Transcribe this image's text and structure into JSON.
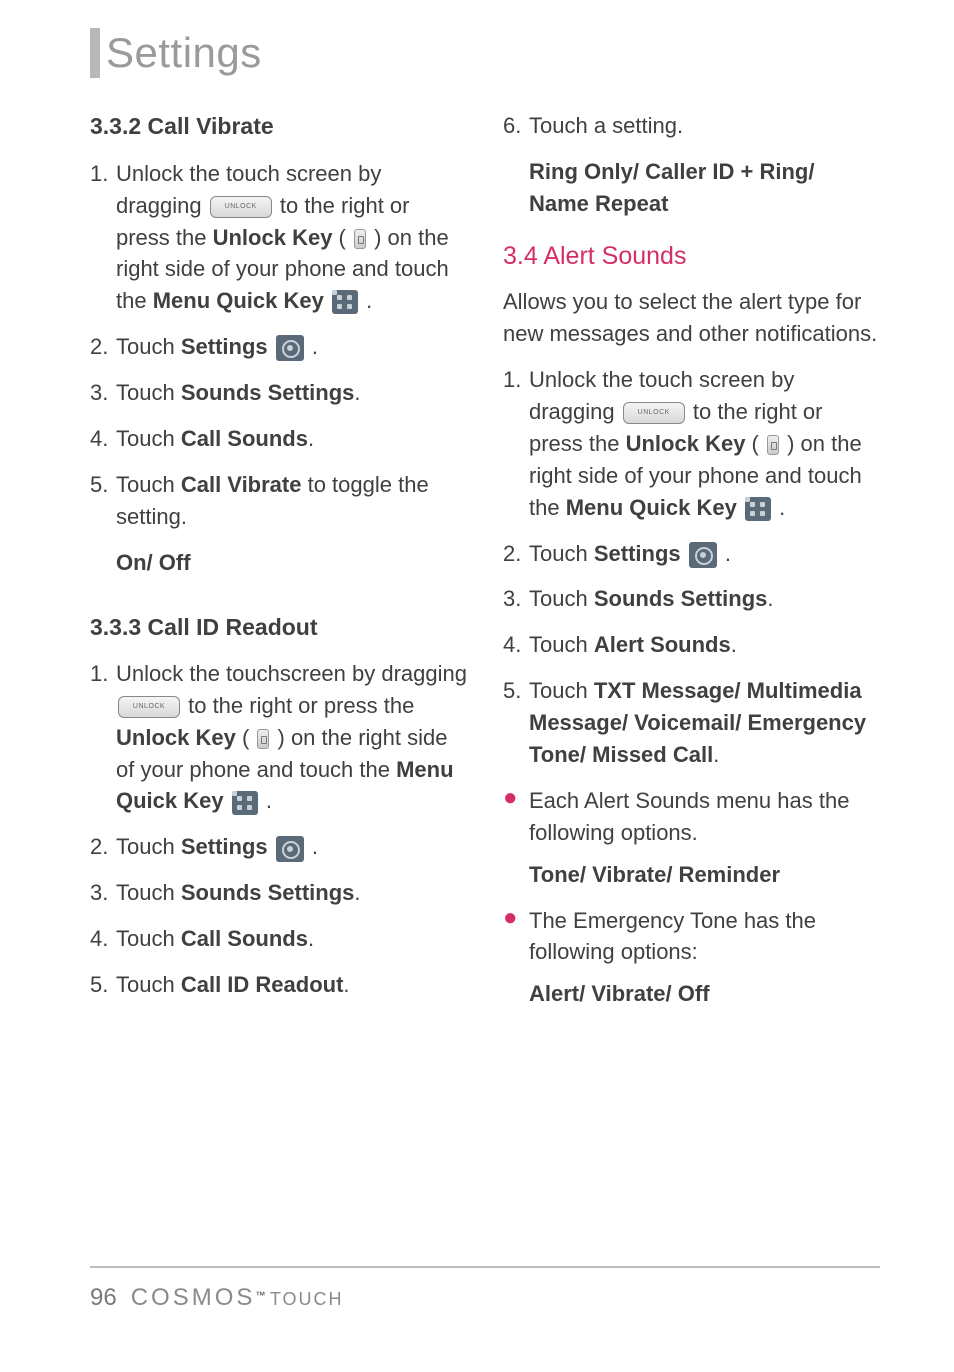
{
  "pageTitle": "Settings",
  "left": {
    "s1_heading": "3.3.2 Call Vibrate",
    "s1_step1_a": "Unlock the touch screen by dragging ",
    "s1_step1_b": " to the right or press the ",
    "s1_step1_unlockkey": "Unlock Key",
    "s1_step1_c": " ( ",
    "s1_step1_d": " ) on the right side of your phone and touch the ",
    "s1_step1_menukey": "Menu Quick Key",
    "s1_step1_e": " .",
    "s1_step2_a": "Touch ",
    "s1_step2_bold": "Settings",
    "s1_step2_b": " .",
    "s1_step3_a": "Touch ",
    "s1_step3_bold": "Sounds Settings",
    "s1_step3_b": ".",
    "s1_step4_a": "Touch ",
    "s1_step4_bold": "Call Sounds",
    "s1_step4_b": ".",
    "s1_step5_a": "Touch ",
    "s1_step5_bold": "Call Vibrate",
    "s1_step5_b": " to toggle the setting.",
    "s1_options": "On/ Off",
    "s2_heading": "3.3.3 Call ID Readout",
    "s2_step1_a": "Unlock the touchscreen by dragging ",
    "s2_step1_b": " to the right or press the ",
    "s2_step1_unlockkey": "Unlock Key",
    "s2_step1_c": " ( ",
    "s2_step1_d": " ) on the right side of your phone and touch the ",
    "s2_step1_menukey": "Menu Quick Key",
    "s2_step1_e": " .",
    "s2_step2_a": "Touch ",
    "s2_step2_bold": "Settings",
    "s2_step2_b": " .",
    "s2_step3_a": "Touch ",
    "s2_step3_bold": "Sounds Settings",
    "s2_step3_b": ".",
    "s2_step4_a": "Touch ",
    "s2_step4_bold": "Call Sounds",
    "s2_step4_b": ".",
    "s2_step5_a": "Touch ",
    "s2_step5_bold": "Call ID Readout",
    "s2_step5_b": "."
  },
  "right": {
    "r1_step6": "Touch a setting.",
    "r1_options": "Ring Only/ Caller ID + Ring/ Name Repeat",
    "r2_heading": "3.4 Alert Sounds",
    "r2_intro": "Allows you to select the alert type for new messages and other notifications.",
    "r2_step1_a": "Unlock the touch screen by dragging ",
    "r2_step1_b": " to the right or press the ",
    "r2_step1_unlockkey": "Unlock Key",
    "r2_step1_c": " ( ",
    "r2_step1_d": " ) on the right side of your phone and touch the ",
    "r2_step1_menukey": "Menu Quick Key",
    "r2_step1_e": " .",
    "r2_step2_a": "Touch ",
    "r2_step2_bold": "Settings",
    "r2_step2_b": " .",
    "r2_step3_a": "Touch ",
    "r2_step3_bold": "Sounds Settings",
    "r2_step3_b": ".",
    "r2_step4_a": "Touch ",
    "r2_step4_bold": "Alert Sounds",
    "r2_step4_b": ".",
    "r2_step5_a": "Touch ",
    "r2_step5_bold": "TXT Message/ Multimedia Message/ Voicemail/ Emergency Tone/ Missed Call",
    "r2_step5_b": ".",
    "r2_bullet1": "Each Alert Sounds menu has the following options.",
    "r2_bullet1_opts": "Tone/ Vibrate/ Reminder",
    "r2_bullet2": "The Emergency Tone has the following options:",
    "r2_bullet2_opts": "Alert/ Vibrate/ Off"
  },
  "footer": {
    "pageNum": "96",
    "brand": "COSMOS",
    "brandSub": "TOUCH",
    "tm": "™"
  },
  "nums": {
    "n1": "1.",
    "n2": "2.",
    "n3": "3.",
    "n4": "4.",
    "n5": "5.",
    "n6": "6."
  }
}
